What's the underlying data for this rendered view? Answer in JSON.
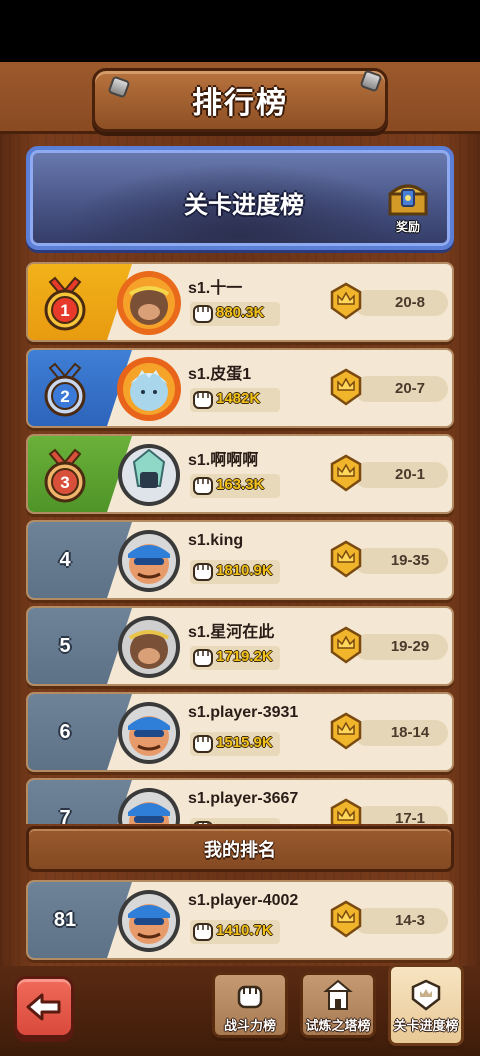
{
  "header": {
    "title": "排行榜"
  },
  "banner": {
    "title": "关卡进度榜",
    "reward_label": "奖励"
  },
  "rows": [
    {
      "rank": "1",
      "name": "s1.十一",
      "power": "880.3K",
      "stage": "20-8",
      "avatar": "monkey-king-flame-avatar"
    },
    {
      "rank": "2",
      "name": "s1.皮蛋1",
      "power": "1482K",
      "stage": "20-7",
      "avatar": "ice-queen-flame-avatar"
    },
    {
      "rank": "3",
      "name": "s1.啊啊啊",
      "power": "163.3K",
      "stage": "20-1",
      "avatar": "crystal-knight-avatar"
    },
    {
      "rank": "4",
      "name": "s1.king",
      "power": "1810.9K",
      "stage": "19-35",
      "avatar": "blue-bandana-hero-avatar"
    },
    {
      "rank": "5",
      "name": "s1.星河在此",
      "power": "1719.2K",
      "stage": "19-29",
      "avatar": "monkey-king-avatar"
    },
    {
      "rank": "6",
      "name": "s1.player-3931",
      "power": "1515.9K",
      "stage": "18-14",
      "avatar": "blue-bandana-hero-avatar"
    },
    {
      "rank": "7",
      "name": "s1.player-3667",
      "power": "",
      "stage": "17-1",
      "avatar": "blue-bandana-hero-avatar"
    }
  ],
  "my_rank": {
    "label": "我的排名",
    "rank": "81",
    "name": "s1.player-4002",
    "power": "1410.7K",
    "stage": "14-3",
    "avatar": "blue-bandana-hero-avatar"
  },
  "tabs": [
    {
      "label": "战斗力榜",
      "icon": "fist-icon",
      "active": false
    },
    {
      "label": "试炼之塔榜",
      "icon": "tower-icon",
      "active": false
    },
    {
      "label": "关卡进度榜",
      "icon": "stage-shield-icon",
      "active": true
    }
  ],
  "colors": {
    "gold": "#f2b21a",
    "silver_blue": "#3f7fd6",
    "bronze_green": "#6ab13a",
    "default_rank": "#6e8398",
    "power_text": "#f3c21a"
  }
}
